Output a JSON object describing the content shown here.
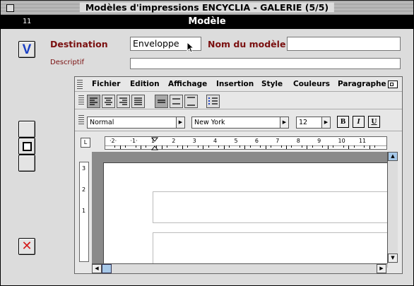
{
  "window": {
    "title": "Modèles d'impressions ENCYCLIA - GALERIE (5/5)"
  },
  "header": {
    "number": "11",
    "title": "Modèle"
  },
  "sidebar": {
    "validate_glyph": "V",
    "cancel_glyph": "✕"
  },
  "form": {
    "destination_label": "Destination",
    "destination_value": "Enveloppe",
    "nom_label": "Nom du modèle",
    "nom_value": "",
    "descriptif_label": "Descriptif",
    "descriptif_value": ""
  },
  "menu": {
    "items": [
      "Fichier",
      "Edition",
      "Affichage",
      "Insertion",
      "Style",
      "Couleurs",
      "Paragraphe"
    ]
  },
  "format": {
    "style": "Normal",
    "font": "New York",
    "size": "12",
    "bold": "B",
    "italic": "I",
    "underline": "U"
  },
  "ruler": {
    "h_marks": [
      "·2·",
      "·1·",
      "1",
      "2",
      "3",
      "4",
      "5",
      "6",
      "7",
      "8",
      "9",
      "10",
      "11"
    ],
    "v_marks": [
      "3",
      "2",
      "1"
    ]
  },
  "colors": {
    "accent": "#7a1010",
    "validate_blue": "#1a3fc4",
    "cancel_red": "#d41a1a",
    "scroll_thumb": "#a6c8e8"
  }
}
